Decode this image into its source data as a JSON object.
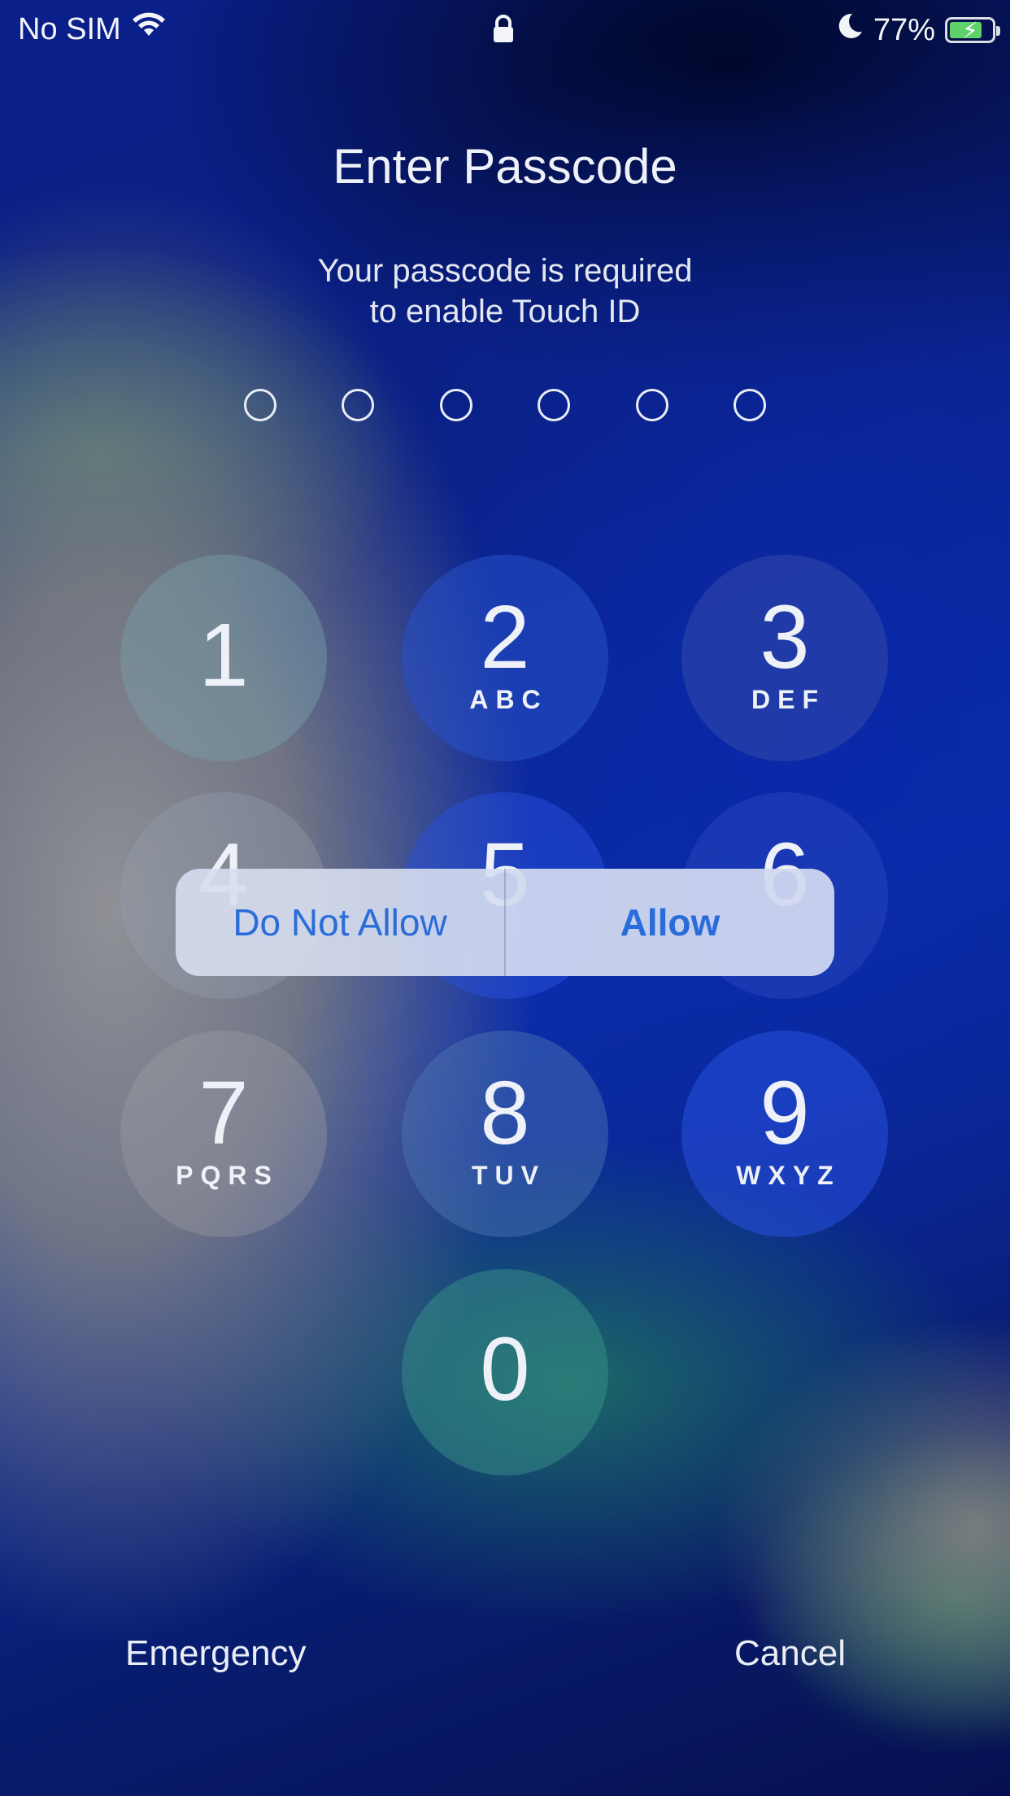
{
  "status_bar": {
    "carrier": "No SIM",
    "wifi_icon": "wifi-icon",
    "lock_icon": "lock-icon",
    "moon_icon": "moon-icon",
    "battery_percent": "77%",
    "battery_level": 0.77,
    "battery_color": "#5fd16b"
  },
  "passcode": {
    "title": "Enter Passcode",
    "subtitle_line1": "Your passcode is required",
    "subtitle_line2": "to enable Touch ID",
    "digits_total": 6,
    "digits_entered": 0
  },
  "keypad": {
    "keys": [
      {
        "num": "1",
        "letters": ""
      },
      {
        "num": "2",
        "letters": "ABC"
      },
      {
        "num": "3",
        "letters": "DEF"
      },
      {
        "num": "4",
        "letters": ""
      },
      {
        "num": "5",
        "letters": ""
      },
      {
        "num": "6",
        "letters": ""
      },
      {
        "num": "7",
        "letters": "PQRS"
      },
      {
        "num": "8",
        "letters": "TUV"
      },
      {
        "num": "9",
        "letters": "WXYZ"
      },
      {
        "num": "0",
        "letters": ""
      }
    ]
  },
  "alert": {
    "deny_label": "Do Not Allow",
    "allow_label": "Allow",
    "accent_color": "#2a6cd9"
  },
  "footer": {
    "emergency_label": "Emergency",
    "cancel_label": "Cancel"
  }
}
